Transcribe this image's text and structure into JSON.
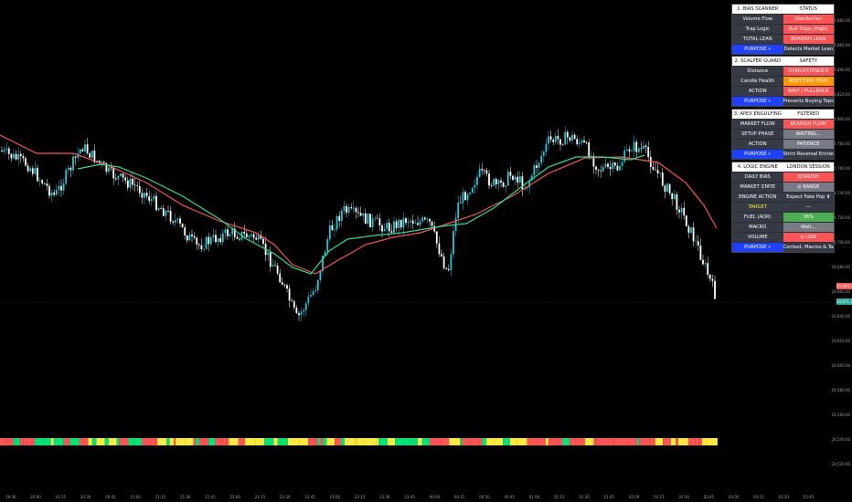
{
  "colors": {
    "background": "#000000",
    "candle_up": "#26c6da",
    "candle_down": "#ffffff",
    "ma_fast": "#26e08a",
    "ma_slow": "#ff5252",
    "heat_red": "#ff5252",
    "heat_yellow": "#ffeb3b",
    "heat_green": "#00e676"
  },
  "price_axis": {
    "labels": [
      "24,880.00",
      "24,860.00",
      "24,840.00",
      "24,820.00",
      "24,800.00",
      "24,780.00",
      "24,760.00",
      "24,740.00",
      "24,720.00",
      "24,700.00",
      "24,680.00",
      "24,660.00",
      "24,640.00",
      "24,620.00",
      "24,600.00",
      "24,580.00",
      "24,560.00",
      "24,540.00",
      "24,520.00"
    ],
    "current_price": "24,690.50",
    "current_price_2": "24,671.25"
  },
  "time_axis": {
    "labels": [
      "19:30",
      "20:00",
      "20:15",
      "20:30",
      "20:45",
      "21:00",
      "21:15",
      "21:30",
      "21:45",
      "22:00",
      "22:15",
      "22:30",
      "22:45",
      "23:00",
      "23:15",
      "23:30",
      "23:45",
      "00:00",
      "00:15",
      "00:30",
      "00:45",
      "01:00",
      "01:15",
      "01:30",
      "01:45",
      "02:00",
      "02:15",
      "02:30",
      "02:45",
      "03:00",
      "03:15",
      "03:30",
      "03:45"
    ]
  },
  "tables": [
    {
      "header": [
        "1. BIAS SCANNER",
        "STATUS"
      ],
      "rows": [
        {
          "label": "Volume Flow",
          "value": "Distribution",
          "style": "val-red"
        },
        {
          "label": "Trap Logic",
          "value": "Bull Traps (High)",
          "style": "val-red"
        },
        {
          "label": "TOTAL LEAN",
          "value": "BEARISH LEAN",
          "style": "val-red"
        },
        {
          "label": "PURPOSE »",
          "value": "Detects Market Lean",
          "style": "val-dark",
          "purpose": true
        }
      ]
    },
    {
      "header": [
        "2. SCALPER GUARD",
        "SAFETY"
      ],
      "rows": [
        {
          "label": "Distance",
          "value": "OVER-EXTENDED",
          "style": "val-red"
        },
        {
          "label": "Candle Health",
          "value": "REJECTING HIGH",
          "style": "val-orange"
        },
        {
          "label": "ACTION",
          "value": "WAIT / PULLBACK",
          "style": "val-red"
        },
        {
          "label": "PURPOSE »",
          "value": "Prevents Buying Tops",
          "style": "val-dark",
          "purpose": true
        }
      ]
    },
    {
      "header": [
        "3. APEX ENGULFING",
        "FILTERED"
      ],
      "rows": [
        {
          "label": "MARKET FLOW",
          "value": "BEARISH FLOW",
          "style": "val-red"
        },
        {
          "label": "SETUP PHASE",
          "value": "WAITING...",
          "style": "val-gray"
        },
        {
          "label": "ACTION",
          "value": "PATIENCE",
          "style": "val-gray"
        },
        {
          "label": "PURPOSE »",
          "value": "Strict Reversal Entries",
          "style": "val-dark",
          "purpose": true
        }
      ]
    },
    {
      "header": [
        "4. LOGIC ENGINE",
        "LONDON SESSION"
      ],
      "rows": [
        {
          "label": "DAILY BIAS",
          "value": "BEARISH",
          "style": "val-red"
        },
        {
          "label": "MARKET STATE",
          "value": "◎ RANGE",
          "style": "val-gray"
        },
        {
          "label": "ENGINE ACTION",
          "value": "Expect Fake Pop ⬆",
          "style": "val-dark"
        },
        {
          "label": "TARGET",
          "value": "---",
          "style": "val-dark",
          "label_style": "val-yellowtxt"
        },
        {
          "label": "FUEL (ADR)",
          "value": "36%",
          "style": "val-green"
        },
        {
          "label": "MACRO",
          "value": "Wait...",
          "style": "val-gray"
        },
        {
          "label": "VOLUME",
          "value": "◎ LOW",
          "style": "val-red"
        },
        {
          "label": "PURPOSE »",
          "value": "Context, Macros & Targets",
          "style": "val-dark",
          "purpose": true
        }
      ]
    }
  ]
}
